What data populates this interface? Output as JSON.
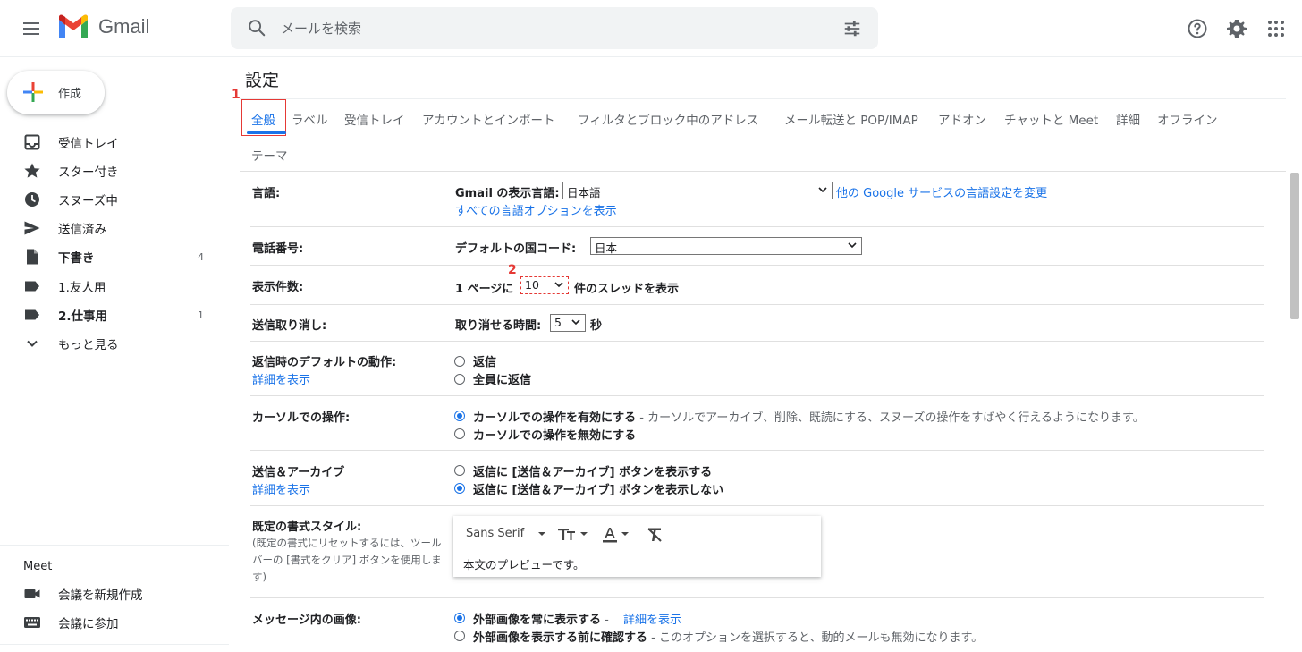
{
  "header": {
    "app_name": "Gmail",
    "search_placeholder": "メールを検索"
  },
  "sidebar": {
    "compose_label": "作成",
    "items": [
      {
        "label": "受信トレイ",
        "icon": "inbox-icon",
        "count": "",
        "bold": false
      },
      {
        "label": "スター付き",
        "icon": "star-icon",
        "count": "",
        "bold": false
      },
      {
        "label": "スヌーズ中",
        "icon": "clock-icon",
        "count": "",
        "bold": false
      },
      {
        "label": "送信済み",
        "icon": "send-icon",
        "count": "",
        "bold": false
      },
      {
        "label": "下書き",
        "icon": "draft-icon",
        "count": "4",
        "bold": true
      },
      {
        "label": "1.友人用",
        "icon": "label-icon",
        "count": "",
        "bold": false
      },
      {
        "label": "2.仕事用",
        "icon": "label-icon",
        "count": "1",
        "bold": true
      },
      {
        "label": "もっと見る",
        "icon": "chevron-down-icon",
        "count": "",
        "bold": false
      }
    ],
    "meet_title": "Meet",
    "meet_items": [
      {
        "label": "会議を新規作成",
        "icon": "video-icon"
      },
      {
        "label": "会議に参加",
        "icon": "keyboard-icon"
      }
    ]
  },
  "settings": {
    "title": "設定",
    "tabs": [
      "全般",
      "ラベル",
      "受信トレイ",
      "アカウントとインポート",
      "フィルタとブロック中のアドレス",
      "メール転送と POP/IMAP",
      "アドオン",
      "チャットと Meet",
      "詳細",
      "オフライン",
      "テーマ"
    ],
    "annotations": [
      "1",
      "2"
    ],
    "language": {
      "label": "言語:",
      "display_language_label": "Gmail の表示言語:",
      "display_language_value": "日本語",
      "other_services_link": "他の Google サービスの言語設定を変更",
      "all_options_link": "すべての言語オプションを表示"
    },
    "phone": {
      "label": "電話番号:",
      "country_code_label": "デフォルトの国コード:",
      "country_code_value": "日本"
    },
    "page_size": {
      "label": "表示件数:",
      "prefix": "1 ページに",
      "value": "10",
      "suffix": "件のスレッドを表示"
    },
    "undo_send": {
      "label": "送信取り消し:",
      "period_label": "取り消せる時間:",
      "value": "5",
      "unit": "秒"
    },
    "reply_default": {
      "label": "返信時のデフォルトの動作:",
      "details_link": "詳細を表示",
      "options": [
        "返信",
        "全員に返信"
      ]
    },
    "hover_actions": {
      "label": "カーソルでの操作:",
      "enable": "カーソルでの操作を有効にする",
      "enable_desc": " - カーソルでアーカイブ、削除、既読にする、スヌーズの操作をすばやく行えるようになります。",
      "disable": "カーソルでの操作を無効にする"
    },
    "send_archive": {
      "label": "送信＆アーカイブ",
      "details_link": "詳細を表示",
      "show": "返信に [送信＆アーカイブ] ボタンを表示する",
      "hide": "返信に [送信＆アーカイブ] ボタンを表示しない"
    },
    "text_style": {
      "label": "既定の書式スタイル:",
      "note": "(既定の書式にリセットするには、ツールバーの [書式をクリア] ボタンを使用します)",
      "font": "Sans Serif",
      "preview": "本文のプレビューです。"
    },
    "images": {
      "label": "メッセージ内の画像:",
      "always": "外部画像を常に表示する",
      "always_sep": " - ",
      "details_link": "詳細を表示",
      "ask": "外部画像を表示する前に確認する",
      "ask_desc": " - このオプションを選択すると、動的メールも無効になります。"
    }
  },
  "colors": {
    "accent": "#1a73e8",
    "annotation": "#e53935"
  }
}
